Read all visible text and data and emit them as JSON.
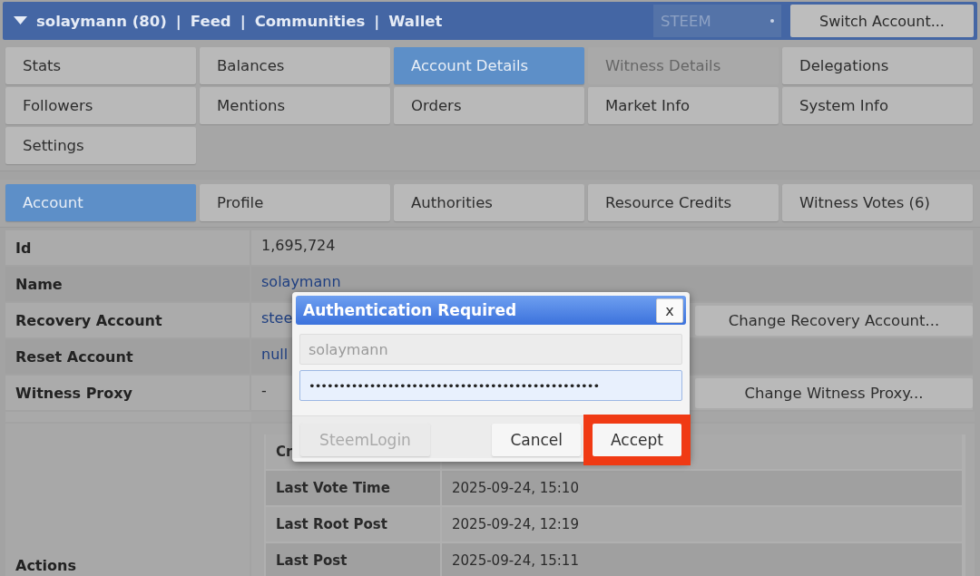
{
  "top_bar": {
    "user": "solaymann (80)",
    "separator": "|",
    "links": [
      "Feed",
      "Communities",
      "Wallet"
    ],
    "chain_select": "STEEM",
    "switch_button": "Switch Account..."
  },
  "nav": [
    {
      "label": "Stats",
      "selected": false,
      "disabled": false
    },
    {
      "label": "Balances",
      "selected": false,
      "disabled": false
    },
    {
      "label": "Account Details",
      "selected": true,
      "disabled": false
    },
    {
      "label": "Witness Details",
      "selected": false,
      "disabled": true
    },
    {
      "label": "Delegations",
      "selected": false,
      "disabled": false
    },
    {
      "label": "Followers",
      "selected": false,
      "disabled": false
    },
    {
      "label": "Mentions",
      "selected": false,
      "disabled": false
    },
    {
      "label": "Orders",
      "selected": false,
      "disabled": false
    },
    {
      "label": "Market Info",
      "selected": false,
      "disabled": false
    },
    {
      "label": "System Info",
      "selected": false,
      "disabled": false
    },
    {
      "label": "Settings",
      "selected": false,
      "disabled": false
    }
  ],
  "subtabs": [
    {
      "label": "Account",
      "selected": true
    },
    {
      "label": "Profile",
      "selected": false
    },
    {
      "label": "Authorities",
      "selected": false
    },
    {
      "label": "Resource Credits",
      "selected": false
    },
    {
      "label": "Witness Votes (6)",
      "selected": false
    }
  ],
  "details": [
    {
      "label": "Id",
      "value": "1,695,724",
      "kind": "text"
    },
    {
      "label": "Name",
      "value": "solaymann",
      "kind": "link"
    },
    {
      "label": "Recovery Account",
      "value": "stee",
      "kind": "link",
      "action": "Change Recovery Account..."
    },
    {
      "label": "Reset Account",
      "value": "null",
      "kind": "link"
    },
    {
      "label": "Witness Proxy",
      "value": "-",
      "kind": "text",
      "action": "Change Witness Proxy..."
    }
  ],
  "actions": {
    "label": "Actions",
    "rows": [
      {
        "label": "Cr"
      },
      {
        "label": "Last Vote Time",
        "value": "2025-09-24, 15:10"
      },
      {
        "label": "Last Root Post",
        "value": "2025-09-24, 12:19"
      },
      {
        "label": "Last Post",
        "value": "2025-09-24, 15:11"
      }
    ]
  },
  "dialog": {
    "title": "Authentication Required",
    "close": "x",
    "username": "solaymann",
    "password": "••••••••••••••••••••••••••••••••••••••••••••••••",
    "buttons": [
      {
        "label": "SteemLogin",
        "disabled": true,
        "highlighted": false
      },
      {
        "label": "Cancel",
        "disabled": false,
        "highlighted": false
      },
      {
        "label": "Accept",
        "disabled": false,
        "highlighted": true
      }
    ]
  }
}
